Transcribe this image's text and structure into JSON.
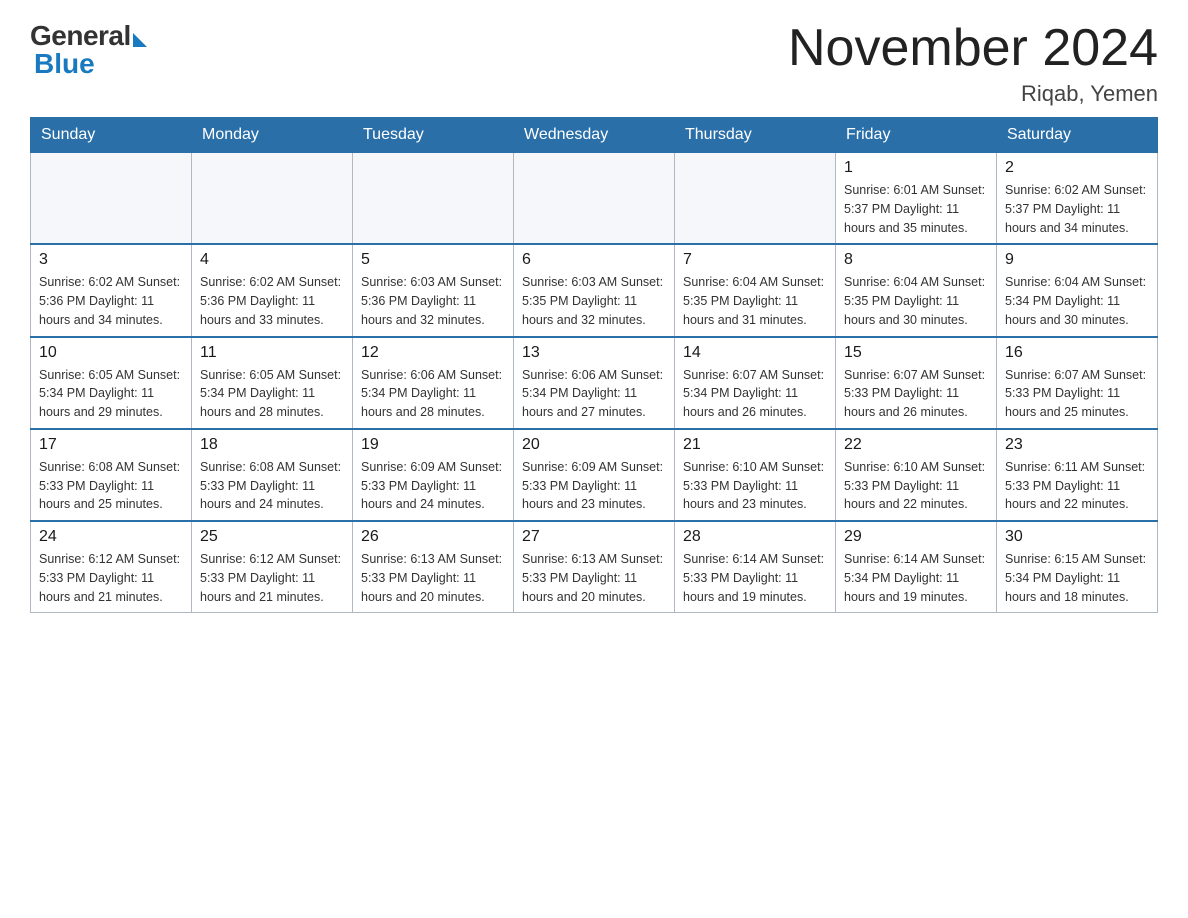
{
  "logo": {
    "general": "General",
    "blue": "Blue"
  },
  "title": "November 2024",
  "subtitle": "Riqab, Yemen",
  "days_header": [
    "Sunday",
    "Monday",
    "Tuesday",
    "Wednesday",
    "Thursday",
    "Friday",
    "Saturday"
  ],
  "weeks": [
    [
      {
        "day": "",
        "info": ""
      },
      {
        "day": "",
        "info": ""
      },
      {
        "day": "",
        "info": ""
      },
      {
        "day": "",
        "info": ""
      },
      {
        "day": "",
        "info": ""
      },
      {
        "day": "1",
        "info": "Sunrise: 6:01 AM\nSunset: 5:37 PM\nDaylight: 11 hours\nand 35 minutes."
      },
      {
        "day": "2",
        "info": "Sunrise: 6:02 AM\nSunset: 5:37 PM\nDaylight: 11 hours\nand 34 minutes."
      }
    ],
    [
      {
        "day": "3",
        "info": "Sunrise: 6:02 AM\nSunset: 5:36 PM\nDaylight: 11 hours\nand 34 minutes."
      },
      {
        "day": "4",
        "info": "Sunrise: 6:02 AM\nSunset: 5:36 PM\nDaylight: 11 hours\nand 33 minutes."
      },
      {
        "day": "5",
        "info": "Sunrise: 6:03 AM\nSunset: 5:36 PM\nDaylight: 11 hours\nand 32 minutes."
      },
      {
        "day": "6",
        "info": "Sunrise: 6:03 AM\nSunset: 5:35 PM\nDaylight: 11 hours\nand 32 minutes."
      },
      {
        "day": "7",
        "info": "Sunrise: 6:04 AM\nSunset: 5:35 PM\nDaylight: 11 hours\nand 31 minutes."
      },
      {
        "day": "8",
        "info": "Sunrise: 6:04 AM\nSunset: 5:35 PM\nDaylight: 11 hours\nand 30 minutes."
      },
      {
        "day": "9",
        "info": "Sunrise: 6:04 AM\nSunset: 5:34 PM\nDaylight: 11 hours\nand 30 minutes."
      }
    ],
    [
      {
        "day": "10",
        "info": "Sunrise: 6:05 AM\nSunset: 5:34 PM\nDaylight: 11 hours\nand 29 minutes."
      },
      {
        "day": "11",
        "info": "Sunrise: 6:05 AM\nSunset: 5:34 PM\nDaylight: 11 hours\nand 28 minutes."
      },
      {
        "day": "12",
        "info": "Sunrise: 6:06 AM\nSunset: 5:34 PM\nDaylight: 11 hours\nand 28 minutes."
      },
      {
        "day": "13",
        "info": "Sunrise: 6:06 AM\nSunset: 5:34 PM\nDaylight: 11 hours\nand 27 minutes."
      },
      {
        "day": "14",
        "info": "Sunrise: 6:07 AM\nSunset: 5:34 PM\nDaylight: 11 hours\nand 26 minutes."
      },
      {
        "day": "15",
        "info": "Sunrise: 6:07 AM\nSunset: 5:33 PM\nDaylight: 11 hours\nand 26 minutes."
      },
      {
        "day": "16",
        "info": "Sunrise: 6:07 AM\nSunset: 5:33 PM\nDaylight: 11 hours\nand 25 minutes."
      }
    ],
    [
      {
        "day": "17",
        "info": "Sunrise: 6:08 AM\nSunset: 5:33 PM\nDaylight: 11 hours\nand 25 minutes."
      },
      {
        "day": "18",
        "info": "Sunrise: 6:08 AM\nSunset: 5:33 PM\nDaylight: 11 hours\nand 24 minutes."
      },
      {
        "day": "19",
        "info": "Sunrise: 6:09 AM\nSunset: 5:33 PM\nDaylight: 11 hours\nand 24 minutes."
      },
      {
        "day": "20",
        "info": "Sunrise: 6:09 AM\nSunset: 5:33 PM\nDaylight: 11 hours\nand 23 minutes."
      },
      {
        "day": "21",
        "info": "Sunrise: 6:10 AM\nSunset: 5:33 PM\nDaylight: 11 hours\nand 23 minutes."
      },
      {
        "day": "22",
        "info": "Sunrise: 6:10 AM\nSunset: 5:33 PM\nDaylight: 11 hours\nand 22 minutes."
      },
      {
        "day": "23",
        "info": "Sunrise: 6:11 AM\nSunset: 5:33 PM\nDaylight: 11 hours\nand 22 minutes."
      }
    ],
    [
      {
        "day": "24",
        "info": "Sunrise: 6:12 AM\nSunset: 5:33 PM\nDaylight: 11 hours\nand 21 minutes."
      },
      {
        "day": "25",
        "info": "Sunrise: 6:12 AM\nSunset: 5:33 PM\nDaylight: 11 hours\nand 21 minutes."
      },
      {
        "day": "26",
        "info": "Sunrise: 6:13 AM\nSunset: 5:33 PM\nDaylight: 11 hours\nand 20 minutes."
      },
      {
        "day": "27",
        "info": "Sunrise: 6:13 AM\nSunset: 5:33 PM\nDaylight: 11 hours\nand 20 minutes."
      },
      {
        "day": "28",
        "info": "Sunrise: 6:14 AM\nSunset: 5:33 PM\nDaylight: 11 hours\nand 19 minutes."
      },
      {
        "day": "29",
        "info": "Sunrise: 6:14 AM\nSunset: 5:34 PM\nDaylight: 11 hours\nand 19 minutes."
      },
      {
        "day": "30",
        "info": "Sunrise: 6:15 AM\nSunset: 5:34 PM\nDaylight: 11 hours\nand 18 minutes."
      }
    ]
  ]
}
